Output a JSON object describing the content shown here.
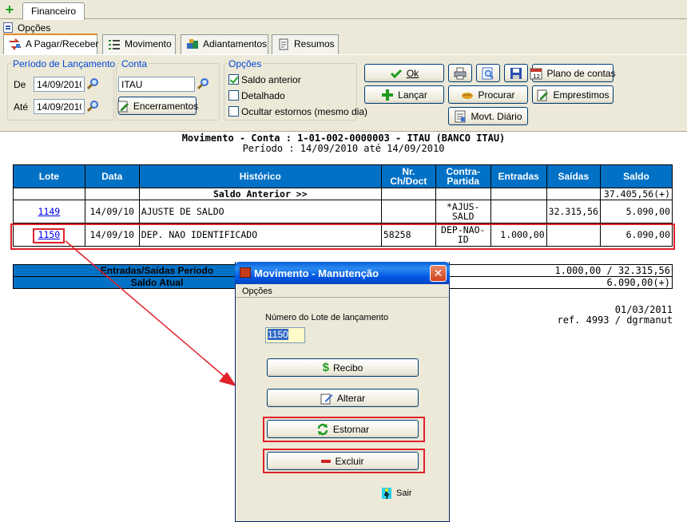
{
  "top_tab": {
    "label": "Financeiro"
  },
  "menu": {
    "options_label": "Opções"
  },
  "main_tabs": [
    {
      "label": "A Pagar/Receber",
      "underline": "A",
      "rest": " Pagar/Receber"
    },
    {
      "label": "Movimento",
      "underline": "M",
      "rest": "ovimento"
    },
    {
      "label": "Adiantamentos",
      "underline": "A",
      "pre": "",
      "rest": "diantamentos"
    },
    {
      "label": "Resumos",
      "underline": "R",
      "rest": "esumos"
    }
  ],
  "filters": {
    "periodo_title": "Período de Lançamento",
    "de_label": "De",
    "de_value": "14/09/2010",
    "ate_label": "Até",
    "ate_value": "14/09/2010",
    "conta_title": "Conta",
    "conta_value": "ITAU",
    "encerramentos_label": "Encerramentos",
    "opcoes_title": "Opções",
    "saldo_anterior_label": "Saldo anterior",
    "detalhado_label": "Detalhado",
    "ocultar_label": "Ocultar estornos (mesmo dia)"
  },
  "toolbar": {
    "ok_label": "Ok",
    "lancar_label": "Lançar",
    "procurar_label": "Procurar",
    "plano_label": "Plano de contas",
    "emprestimos_label": "Emprestimos",
    "diario_label": "Movt. Diário"
  },
  "report": {
    "title": "Movimento - Conta : 1-01-002-0000003 - ITAU (BANCO ITAU)",
    "subtitle": "Período : 14/09/2010 até 14/09/2010",
    "columns": [
      "Lote",
      "Data",
      "Histórico",
      "Nr. Ch/Doct",
      "Contra-Partida",
      "Entradas",
      "Saídas",
      "Saldo"
    ],
    "col_nr_1": "Nr.",
    "col_nr_2": "Ch/Doct",
    "col_contra_1": "Contra-",
    "col_contra_2": "Partida",
    "saldo_anterior": {
      "label": "Saldo Anterior >>",
      "saldo": "37.405,56(+)"
    },
    "rows": [
      {
        "lote": "1149",
        "data": "14/09/10",
        "historico": "AJUSTE DE SALDO",
        "doc": "",
        "contra_1": "*AJUS-",
        "contra_2": "SALD",
        "entradas": "",
        "saidas": "32.315,56",
        "saldo": "5.090,00"
      },
      {
        "lote": "1150",
        "data": "14/09/10",
        "historico": "DEP. NAO IDENTIFICADO",
        "doc": "58258",
        "contra_1": "DEP-NAO-",
        "contra_2": "ID",
        "entradas": "1.000,00",
        "saidas": "",
        "saldo": "6.090,00"
      }
    ],
    "totals": {
      "entradas_saidas_label": "Entradas/Saídas Período",
      "entradas_saidas_value": "1.000,00 / 32.315,56",
      "saldo_atual_label": "Saldo Atual",
      "saldo_atual_value": "6.090,00(+)"
    },
    "footer_date": "01/03/2011",
    "footer_ref": "ref. 4993 / dgrmanut"
  },
  "dialog": {
    "title": "Movimento - Manutenção",
    "menu_label": "Opções",
    "lote_label": "Número do Lote de lançamento",
    "lote_value": "1150",
    "recibo_label": "Recibo",
    "alterar_label": "Alterar",
    "estornar_label": "Estornar",
    "excluir_label": "Excluir",
    "sair_label": "Sair"
  },
  "colors": {
    "header_blue": "#0071c5",
    "highlight_red": "#e0202a",
    "title_blue": "#0054e3"
  }
}
